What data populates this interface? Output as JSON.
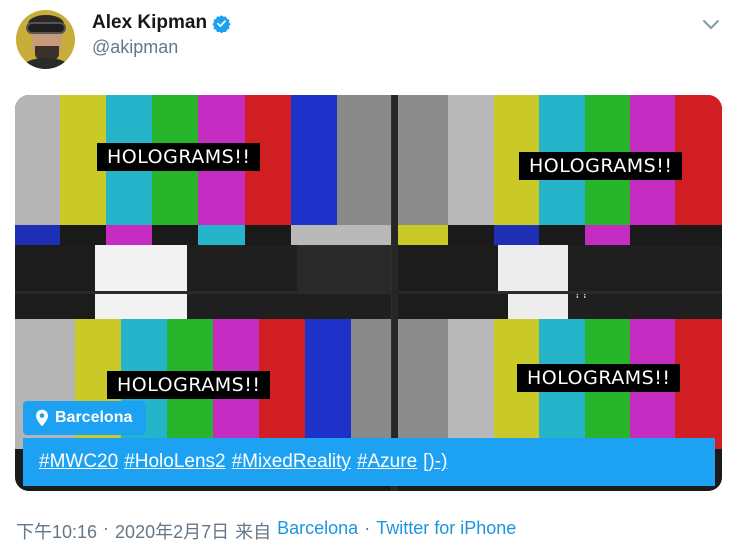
{
  "author": {
    "display_name": "Alex Kipman",
    "handle": "@akipman",
    "verified": true
  },
  "media": {
    "screen_label": "HOLOGRAMS!!",
    "screen_subtext": "??",
    "location_tag": "Barcelona",
    "caption": {
      "hashtags": [
        "#MWC20",
        "#HoloLens2",
        "#MixedReality",
        "#Azure"
      ],
      "tail": "[)-)"
    }
  },
  "meta": {
    "time": "下午10:16",
    "separator": "·",
    "date": "2020年2月7日",
    "from_label": "来自",
    "place": "Barcelona",
    "client": "Twitter for iPhone"
  },
  "colors": {
    "accent": "#1da1f2",
    "link": "#1b95e0",
    "muted": "#657786",
    "verified_badge": "#1da1f2"
  }
}
